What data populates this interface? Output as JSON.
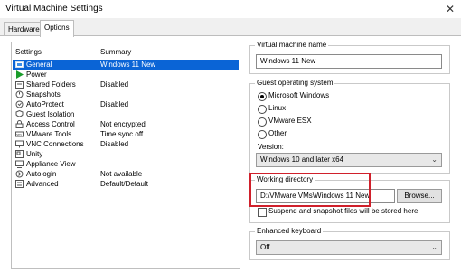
{
  "window": {
    "title": "Virtual Machine Settings",
    "close_glyph": "✕"
  },
  "tabs": [
    {
      "label": "Hardware",
      "active": false
    },
    {
      "label": "Options",
      "active": true
    }
  ],
  "settings_list": {
    "col_settings": "Settings",
    "col_summary": "Summary",
    "rows": [
      {
        "label": "General",
        "summary": "Windows 11 New",
        "icon": "general-icon",
        "selected": true
      },
      {
        "label": "Power",
        "summary": "",
        "icon": "power-icon",
        "selected": false
      },
      {
        "label": "Shared Folders",
        "summary": "Disabled",
        "icon": "shared-folders-icon",
        "selected": false
      },
      {
        "label": "Snapshots",
        "summary": "",
        "icon": "snapshots-icon",
        "selected": false
      },
      {
        "label": "AutoProtect",
        "summary": "Disabled",
        "icon": "autoprotect-icon",
        "selected": false
      },
      {
        "label": "Guest Isolation",
        "summary": "",
        "icon": "guest-isolation-icon",
        "selected": false
      },
      {
        "label": "Access Control",
        "summary": "Not encrypted",
        "icon": "access-control-icon",
        "selected": false
      },
      {
        "label": "VMware Tools",
        "summary": "Time sync off",
        "icon": "vmware-tools-icon",
        "selected": false
      },
      {
        "label": "VNC Connections",
        "summary": "Disabled",
        "icon": "vnc-icon",
        "selected": false
      },
      {
        "label": "Unity",
        "summary": "",
        "icon": "unity-icon",
        "selected": false
      },
      {
        "label": "Appliance View",
        "summary": "",
        "icon": "appliance-view-icon",
        "selected": false
      },
      {
        "label": "Autologin",
        "summary": "Not available",
        "icon": "autologin-icon",
        "selected": false
      },
      {
        "label": "Advanced",
        "summary": "Default/Default",
        "icon": "advanced-icon",
        "selected": false
      }
    ]
  },
  "vm_name": {
    "title": "Virtual machine name",
    "value": "Windows 11 New"
  },
  "guest_os": {
    "title": "Guest operating system",
    "options": [
      {
        "label": "Microsoft Windows",
        "checked": true
      },
      {
        "label": "Linux",
        "checked": false
      },
      {
        "label": "VMware ESX",
        "checked": false
      },
      {
        "label": "Other",
        "checked": false
      }
    ],
    "version_label": "Version:",
    "version_value": "Windows 10 and later x64"
  },
  "working_directory": {
    "title": "Working directory",
    "path": "D:\\VMware VMs\\Windows 11 New",
    "browse_label": "Browse...",
    "note": "Suspend and snapshot files will be stored here.",
    "highlight_color": "#d0202b"
  },
  "enhanced_keyboard": {
    "title": "Enhanced keyboard",
    "value": "Off"
  },
  "colors": {
    "selection": "#0a64d6",
    "power_green": "#1a9c2a"
  }
}
